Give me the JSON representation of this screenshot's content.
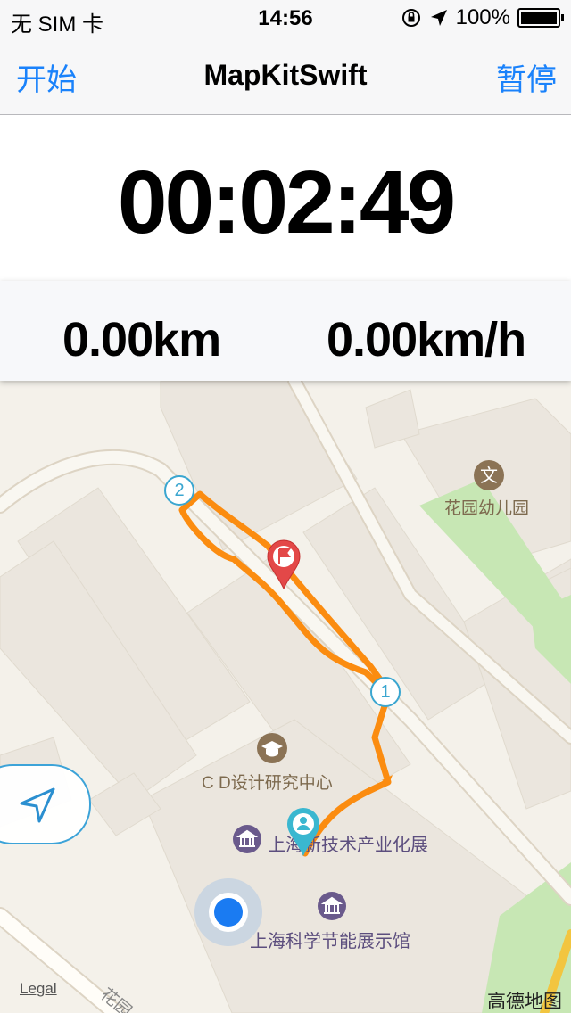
{
  "status_bar": {
    "carrier": "无 SIM 卡",
    "time": "14:56",
    "battery": "100%",
    "icons": [
      "rotation-lock-icon",
      "location-arrow-icon",
      "battery-icon"
    ]
  },
  "nav": {
    "start_label": "开始",
    "title": "MapKitSwift",
    "pause_label": "暂停",
    "accent": "#1a82fb"
  },
  "timer": {
    "value": "00:02:49"
  },
  "stats": {
    "distance": "0.00km",
    "speed": "0.00km/h"
  },
  "map": {
    "route_color": "#fb8c10",
    "markers": [
      {
        "label": "1",
        "icon": "waypoint-1-icon"
      },
      {
        "label": "2",
        "icon": "waypoint-2-icon"
      }
    ],
    "pois": [
      {
        "name": "花园幼儿园",
        "icon": "school-icon"
      },
      {
        "name": "C D设计研究中心",
        "icon": "graduation-cap-icon"
      },
      {
        "name": "上海新技术产业化展",
        "icon": "museum-icon"
      },
      {
        "name": "上海科学节能展示馆",
        "icon": "museum-icon"
      }
    ],
    "road_label": "花园",
    "legal": "Legal",
    "brand": "高德地图"
  }
}
